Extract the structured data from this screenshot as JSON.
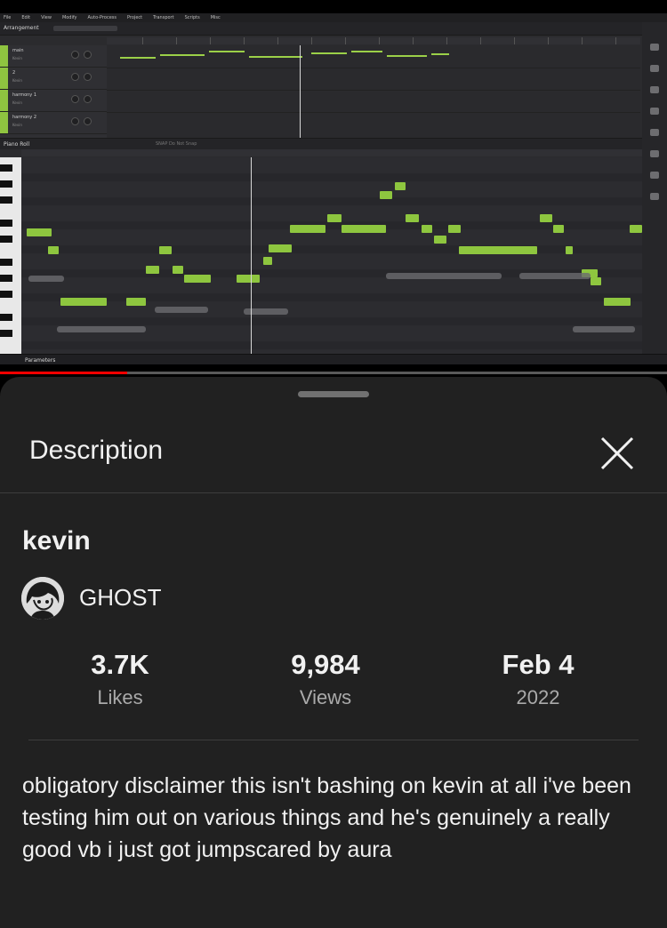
{
  "video": {
    "daw": {
      "menu": [
        "File",
        "Edit",
        "View",
        "Modify",
        "Auto-Process",
        "Project",
        "Transport",
        "Scripts",
        "Misc"
      ],
      "arrangement_label": "Arrangement",
      "tracks": [
        {
          "name": "main",
          "sub": "Kevin"
        },
        {
          "name": "2",
          "sub": "Kevin"
        },
        {
          "name": "harmony 1",
          "sub": "Kevin"
        },
        {
          "name": "harmony 2",
          "sub": "Kevin"
        }
      ],
      "piano_roll_label": "Piano Roll",
      "snap_label": "SNAP  Do Not Snap",
      "parameters_label": "Parameters"
    },
    "progress_fraction": 0.19
  },
  "sheet": {
    "title": "Description",
    "close_icon": "close-icon",
    "video_title": "kevin",
    "channel_name": "GHOST",
    "stats": [
      {
        "value": "3.7K",
        "label": "Likes"
      },
      {
        "value": "9,984",
        "label": "Views"
      },
      {
        "value": "Feb 4",
        "label": "2022"
      }
    ],
    "description": "obligatory disclaimer this isn't bashing on kevin at all i've been testing him out on various things and he's genuinely a really good vb i just got jumpscared by aura"
  }
}
